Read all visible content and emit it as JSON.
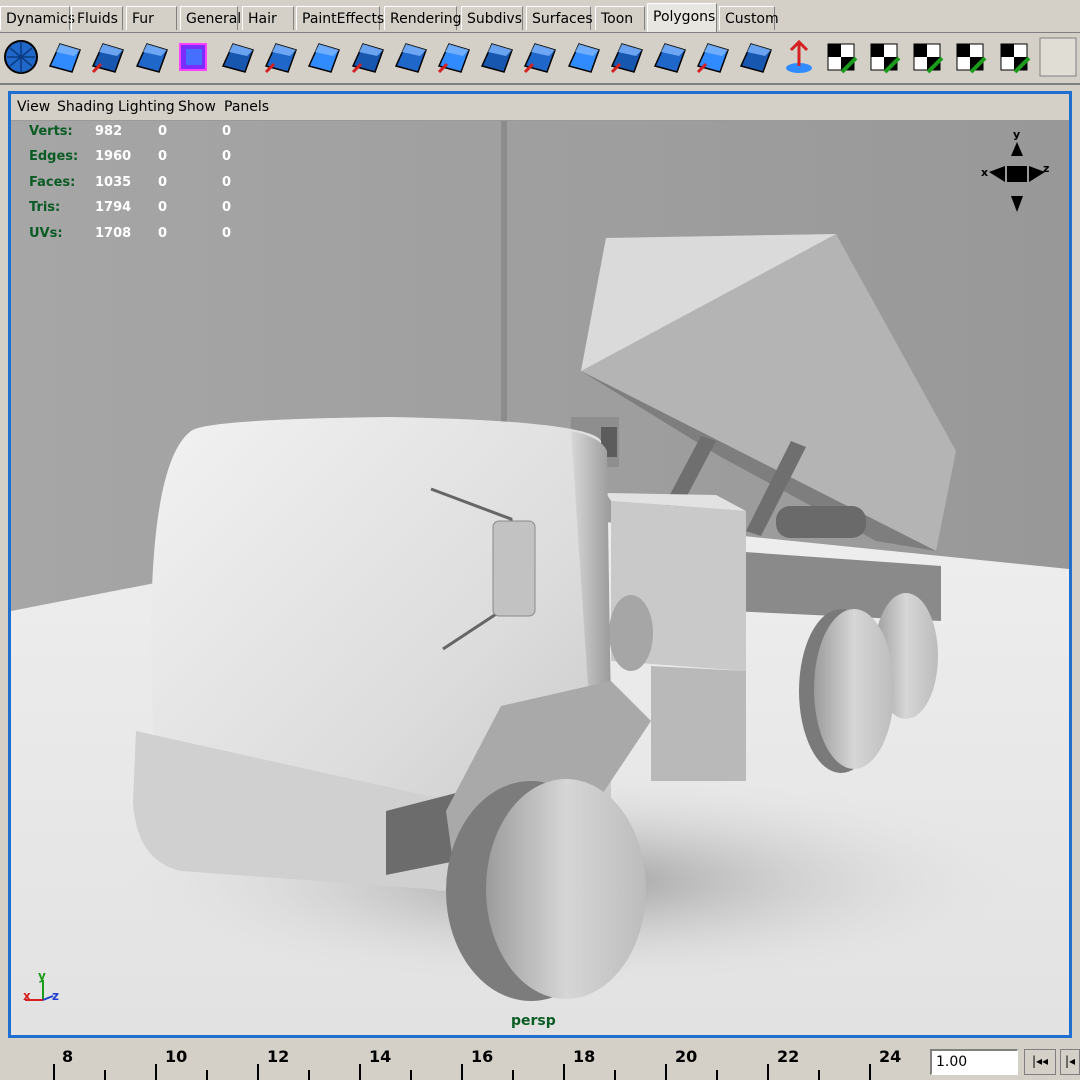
{
  "shelf_tabs": [
    {
      "label": "Dynamics",
      "active": false
    },
    {
      "label": "Fluids",
      "active": false
    },
    {
      "label": "Fur",
      "active": false
    },
    {
      "label": "General",
      "active": false
    },
    {
      "label": "Hair",
      "active": false
    },
    {
      "label": "PaintEffects",
      "active": false
    },
    {
      "label": "Rendering",
      "active": false
    },
    {
      "label": "Subdivs",
      "active": false
    },
    {
      "label": "Surfaces",
      "active": false
    },
    {
      "label": "Toon",
      "active": false
    },
    {
      "label": "Polygons",
      "active": true
    },
    {
      "label": "Custom",
      "active": false
    }
  ],
  "shelf_icons": [
    "polygon-sphere-icon",
    "extract-faces-icon",
    "smooth-proxy-icon",
    "combine-objects-icon",
    "polygon-cube-icon",
    "split-polygon-icon",
    "select-edge-icon",
    "extrude-face-icon",
    "bevel-icon",
    "create-polygon-icon",
    "append-polygon-icon",
    "split-edge-icon",
    "merge-vertices-icon",
    "insert-edge-loop-icon",
    "collapse-icon",
    "poke-face-icon",
    "flip-faces-icon",
    "sculpt-icon",
    "transfer-uv-icon",
    "automatic-map-icon",
    "planar-map-icon",
    "cylindrical-map-icon",
    "spherical-map-icon",
    "uv-texture-editor-icon",
    "blank-shelf-slot-icon"
  ],
  "panel_menu": [
    "View",
    "Shading",
    "Lighting",
    "Show",
    "Panels"
  ],
  "hud": [
    {
      "label": "Verts:",
      "v1": "982",
      "v2": "0",
      "v3": "0"
    },
    {
      "label": "Edges:",
      "v1": "1960",
      "v2": "0",
      "v3": "0"
    },
    {
      "label": "Faces:",
      "v1": "1035",
      "v2": "0",
      "v3": "0"
    },
    {
      "label": "Tris:",
      "v1": "1794",
      "v2": "0",
      "v3": "0"
    },
    {
      "label": "UVs:",
      "v1": "1708",
      "v2": "0",
      "v3": "0"
    }
  ],
  "view_cube_axes": {
    "y": "y",
    "x": "x",
    "z": "z"
  },
  "axis_indicator": {
    "x": "x",
    "y": "y",
    "z": "z"
  },
  "camera_name": "persp",
  "timeline_ticks": [
    "8",
    "10",
    "12",
    "14",
    "16",
    "18",
    "20",
    "22",
    "24"
  ],
  "current_frame": "1.00",
  "playback_buttons": [
    "|◂◂",
    "|◂"
  ],
  "colors": {
    "viewport_border": "#1f6fd1",
    "hud_label": "#0a5c24",
    "hud_value": "#ffffff",
    "shelf_bg": "#d4d0c8"
  }
}
